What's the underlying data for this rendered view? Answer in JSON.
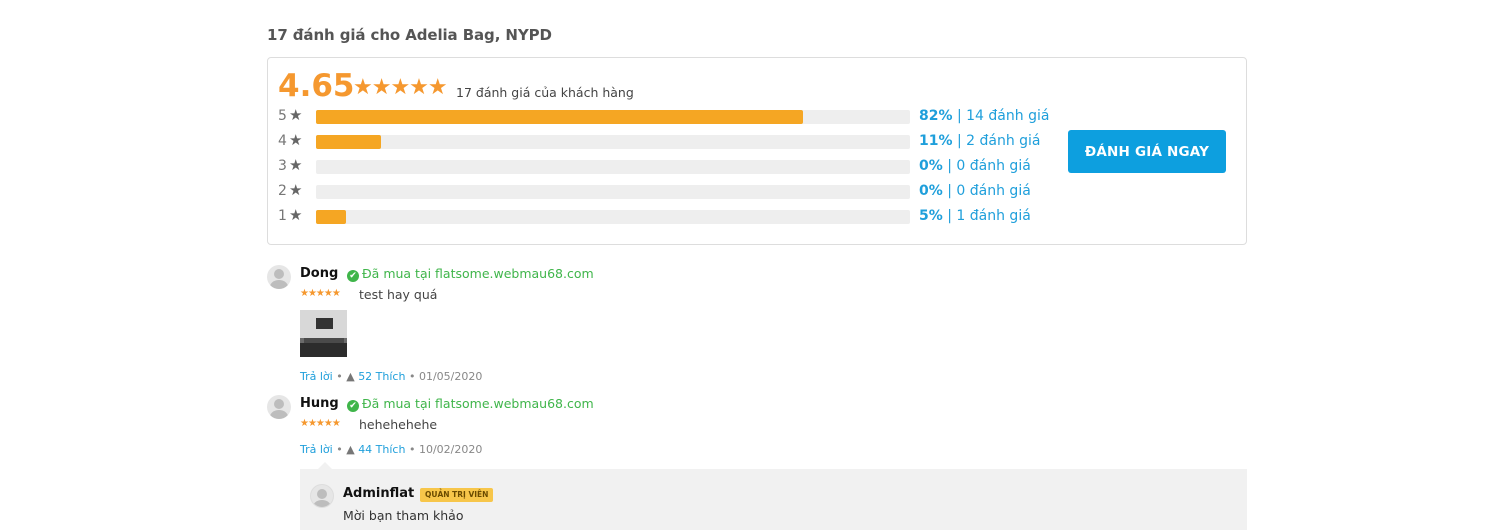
{
  "title": "17 đánh giá cho Adelia Bag, NYPD",
  "summary": {
    "average": "4.65",
    "stars": "★★★★★",
    "count_label": "17 đánh giá của khách hàng",
    "rate_button": "ĐÁNH GIÁ NGAY",
    "accent_color": "#f5982f",
    "button_color": "#0d9fdf",
    "rows": [
      {
        "stars": "5",
        "percent_label": "82%",
        "count_label": "14 đánh giá",
        "percent": 82
      },
      {
        "stars": "4",
        "percent_label": "11%",
        "count_label": "2 đánh giá",
        "percent": 11
      },
      {
        "stars": "3",
        "percent_label": "0%",
        "count_label": "0 đánh giá",
        "percent": 0
      },
      {
        "stars": "2",
        "percent_label": "0%",
        "count_label": "0 đánh giá",
        "percent": 0
      },
      {
        "stars": "1",
        "percent_label": "5%",
        "count_label": "1 đánh giá",
        "percent": 5
      }
    ]
  },
  "reviews": [
    {
      "name": "Dong",
      "verified": "Đã mua tại flatsome.webmau68.com",
      "stars": "★★★★★",
      "text": "test hay quá",
      "reply": "Trả lời",
      "likes": "52 Thích",
      "date": "01/05/2020"
    },
    {
      "name": "Hung",
      "verified": "Đã mua tại flatsome.webmau68.com",
      "stars": "★★★★★",
      "text": "hehehehehe",
      "reply": "Trả lời",
      "likes": "44 Thích",
      "date": "10/02/2020"
    }
  ],
  "admin_reply": {
    "name": "Adminflat",
    "badge": "QUẢN TRỊ VIÊN",
    "text": "Mời bạn tham khảo"
  },
  "separator": "•",
  "star_glyph": "★",
  "check_glyph": "✔",
  "like_glyph": "👍"
}
